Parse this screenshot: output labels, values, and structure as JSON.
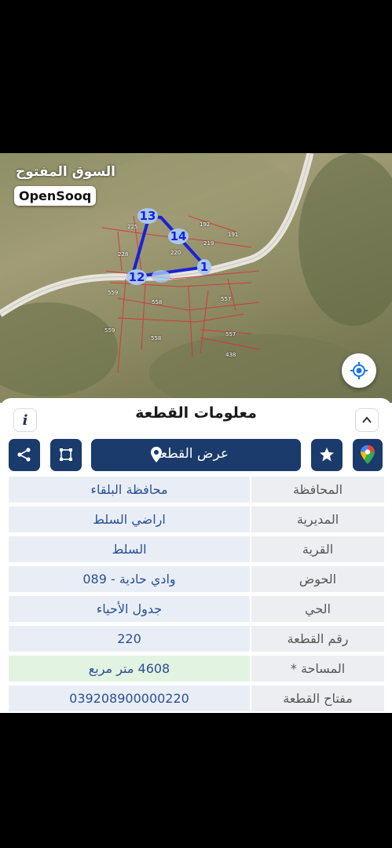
{
  "watermark": {
    "arabic": "السوق المفتوح",
    "brand": "OpenSooq"
  },
  "map": {
    "plot_labels": [
      "13",
      "14",
      "12",
      "1",
      "225",
      "192",
      "191",
      "219",
      "220",
      "228",
      "559",
      "558",
      "557",
      "557",
      "559",
      "558",
      "438"
    ],
    "locate_icon": "my-location-icon"
  },
  "sheet": {
    "title": "معلومات القطعة",
    "info_label": "i",
    "collapse_icon": "chevron-up-icon",
    "actions": {
      "share_icon": "share-icon",
      "crop_icon": "crop-square-icon",
      "show_plot_label": "عرض القطعة",
      "show_plot_icon": "location-pin-icon",
      "favorite_icon": "star-icon",
      "maps_icon": "google-maps-icon"
    },
    "rows": [
      {
        "label": "المحافظة",
        "value": "محافظة البلقاء"
      },
      {
        "label": "المديرية",
        "value": "اراضي السلط"
      },
      {
        "label": "القرية",
        "value": "السلط"
      },
      {
        "label": "الحوض",
        "value": "وادي حادية - 089"
      },
      {
        "label": "الحي",
        "value": "جدول الأحياء"
      },
      {
        "label": "رقم القطعة",
        "value": "220"
      },
      {
        "label": "المساحة *",
        "value": "4608  متر مربع"
      },
      {
        "label": "مفتاح القطعة",
        "value": "039208900000220"
      }
    ]
  },
  "colors": {
    "accent": "#1a3b6b",
    "value_text": "#2a4f93",
    "plot_outline": "#1a22d8",
    "parcel_lines": "#d8323a"
  }
}
